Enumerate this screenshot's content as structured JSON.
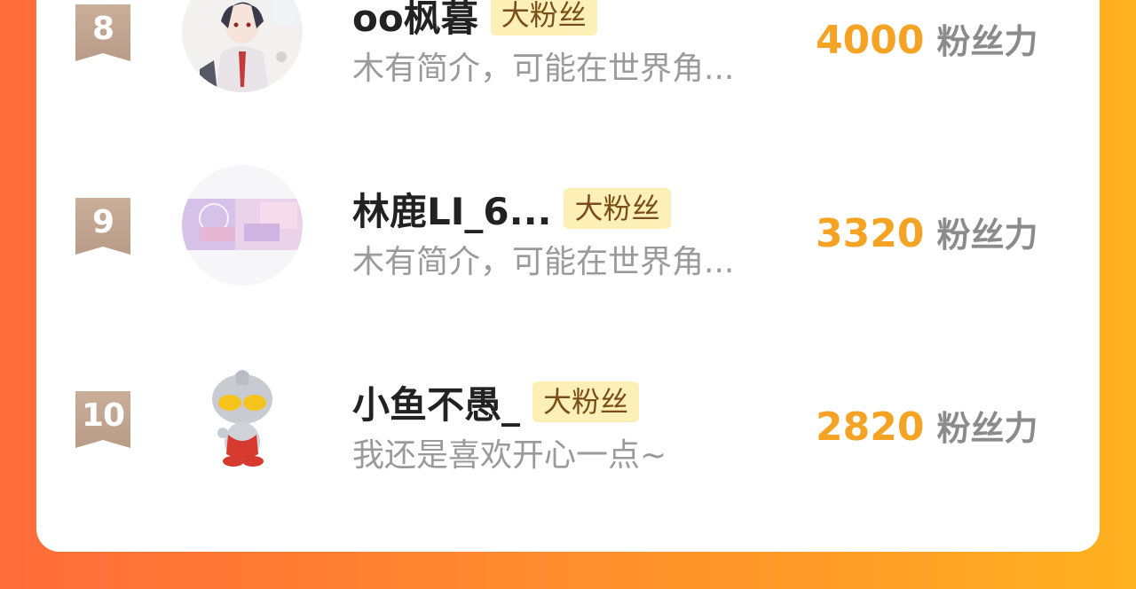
{
  "rows": [
    {
      "rank": "8",
      "name": "oo枫暮",
      "badge": "大粉丝",
      "bio": "木有简介，可能在世界角...",
      "score": "4000",
      "unit": "粉丝力",
      "avatar_icon": "anime-boy-avatar"
    },
    {
      "rank": "9",
      "name": "林鹿LI_6...",
      "badge": "大粉丝",
      "bio": "木有简介，可能在世界角...",
      "score": "3320",
      "unit": "粉丝力",
      "avatar_icon": "pink-room-avatar"
    },
    {
      "rank": "10",
      "name": "小鱼不愚_",
      "badge": "大粉丝",
      "bio": "我还是喜欢开心一点~",
      "score": "2820",
      "unit": "粉丝力",
      "avatar_icon": "ultraman-avatar"
    }
  ],
  "colors": {
    "score": "#f5a324",
    "badge_bg": "#fdf0b6",
    "rank_badge": "#c1a692"
  }
}
